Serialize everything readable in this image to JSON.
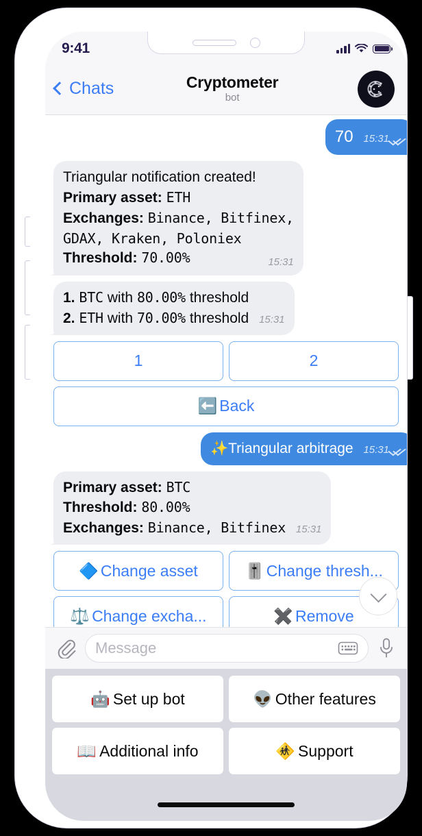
{
  "status_bar": {
    "time": "9:41",
    "signal_icon": "signal-bars-icon",
    "wifi_icon": "wifi-icon",
    "battery_icon": "battery-icon"
  },
  "nav": {
    "back_label": "Chats",
    "title": "Cryptometer",
    "subtitle": "bot",
    "avatar_letter": "C"
  },
  "messages": [
    {
      "id": "msg-70",
      "direction": "outgoing",
      "text": "70",
      "time": "15:31",
      "read": true
    },
    {
      "id": "msg-notification-created",
      "direction": "incoming",
      "line1": "Triangular notification created!",
      "label_asset": "Primary asset",
      "value_asset": "ETH",
      "label_exchanges": "Exchanges",
      "value_exchanges_1": "Binance, Bitfinex,",
      "value_exchanges_2": "GDAX, Kraken, Poloniex",
      "label_threshold": "Threshold",
      "value_threshold": "70.00%",
      "time": "15:31"
    },
    {
      "id": "msg-notification-list",
      "direction": "incoming",
      "item1_num": "1.",
      "item1_asset": "BTC",
      "item1_mid": "with",
      "item1_value": "80.00%",
      "item1_tail": "threshold",
      "item2_num": "2.",
      "item2_asset": "ETH",
      "item2_mid": "with",
      "item2_value": "70.00%",
      "item2_tail": "threshold",
      "time": "15:31"
    },
    {
      "id": "msg-triangular-arbitrage",
      "direction": "outgoing",
      "emoji": "✨",
      "text": "Triangular arbitrage",
      "time": "15:31",
      "read": true
    },
    {
      "id": "msg-btc-details",
      "direction": "incoming",
      "label_asset": "Primary asset",
      "value_asset": "BTC",
      "label_threshold": "Threshold",
      "value_threshold": "80.00%",
      "label_exchanges": "Exchanges",
      "value_exchanges": "Binance, Bitfinex",
      "time": "15:31"
    }
  ],
  "inline_keyboard_1": {
    "rows": [
      [
        {
          "label": "1",
          "emoji": ""
        },
        {
          "label": "2",
          "emoji": ""
        }
      ],
      [
        {
          "label": "Back",
          "emoji": "⬅️"
        }
      ]
    ]
  },
  "inline_keyboard_2": {
    "rows": [
      [
        {
          "label": "Change asset",
          "emoji": "🔷"
        },
        {
          "label": "Change thresh...",
          "emoji": "🎚️"
        }
      ],
      [
        {
          "label": "Change excha...",
          "emoji": "⚖️"
        },
        {
          "label": "Remove",
          "emoji": "✖️"
        }
      ]
    ]
  },
  "scroll_down_button": {
    "icon": "chevron-down-icon"
  },
  "input_bar": {
    "attach_icon": "paperclip-icon",
    "placeholder": "Message",
    "keyboard_icon": "keyboard-icon",
    "mic_icon": "microphone-icon"
  },
  "reply_keyboard": {
    "rows": [
      [
        {
          "emoji": "🤖",
          "label": "Set up bot"
        },
        {
          "emoji": "👽",
          "label": "Other features"
        }
      ],
      [
        {
          "emoji": "📖",
          "label": "Additional info"
        },
        {
          "emoji": "🚸",
          "label": "Support"
        }
      ]
    ]
  },
  "colors": {
    "accent_blue": "#3b7df6",
    "outgoing_bubble": "#3f8ae0",
    "incoming_bubble": "#eceef2",
    "status_icon": "#2d2150",
    "keyboard_bg": "#d8d8e0"
  }
}
